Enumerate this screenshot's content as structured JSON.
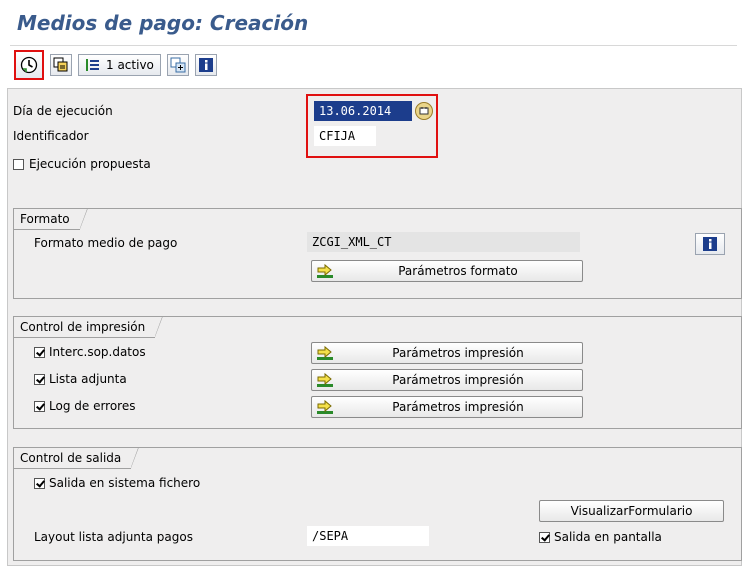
{
  "title": "Medios de pago: Creación",
  "toolbar": {
    "active_label": "1 activo",
    "icons": [
      "execute-icon",
      "copy-icon",
      "multiselect-icon",
      "expand-icon",
      "info-icon"
    ]
  },
  "header": {
    "run_date_label": "Día de ejecución",
    "run_date_value": "13.06.2014",
    "identifier_label": "Identificador",
    "identifier_value": "CFIJA",
    "proposal_label": "Ejecución propuesta",
    "proposal_checked": false
  },
  "format_section": {
    "tab": "Formato",
    "format_label": "Formato medio de pago",
    "format_value": "ZCGI_XML_CT",
    "params_button": "Parámetros formato"
  },
  "print_section": {
    "tab": "Control de impresión",
    "rows": [
      {
        "label": "Interc.sop.datos",
        "checked": true,
        "button": "Parámetros impresión"
      },
      {
        "label": "Lista adjunta",
        "checked": true,
        "button": "Parámetros impresión"
      },
      {
        "label": "Log de errores",
        "checked": true,
        "button": "Parámetros impresión"
      }
    ]
  },
  "output_section": {
    "tab": "Control de salida",
    "file_system_label": "Salida en sistema fichero",
    "file_system_checked": true,
    "visualize_button": "VisualizarFormulario",
    "layout_label": "Layout lista adjunta pagos",
    "layout_value": "/SEPA",
    "screen_label": "Salida en pantalla",
    "screen_checked": true
  },
  "colors": {
    "title": "#3a5b8c",
    "highlight": "#e01010",
    "selected_field": "#1c3d8c",
    "panel": "#efeeee"
  }
}
